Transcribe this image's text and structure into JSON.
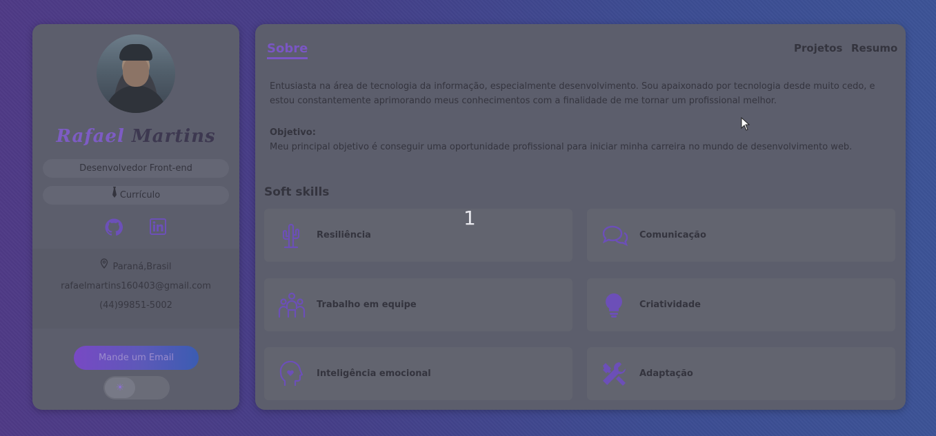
{
  "profile": {
    "first_name": "Rafael",
    "last_name": "Martins",
    "role": "Desenvolvedor Front-end",
    "resume_label": "Currículo",
    "social": [
      {
        "name": "github",
        "icon": "github-icon"
      },
      {
        "name": "linkedin",
        "icon": "linkedin-icon"
      }
    ],
    "location": "Paraná,Brasil",
    "email": "rafaelmartins160403@gmail.com",
    "phone": "(44)99851-5002",
    "email_button": "Mande um Email",
    "theme_toggle_icon": "☀"
  },
  "nav": {
    "active_tab": "Sobre",
    "tabs": [
      "Projetos",
      "Resumo"
    ]
  },
  "about": {
    "intro": "Entusiasta na área de tecnologia da informação, especialmente desenvolvimento. Sou apaixonado por tecnologia desde muito cedo, e estou constantemente aprimorando meus conhecimentos com a finalidade de me tornar um profissional melhor.",
    "objective_label": "Objetivo:",
    "objective": "Meu principal objetivo é conseguir uma oportunidade profissional para iniciar minha carreira no mundo de desenvolvimento web."
  },
  "skills": {
    "title": "Soft skills",
    "items": [
      {
        "label": "Resiliência",
        "icon": "cactus-icon"
      },
      {
        "label": "Comunicação",
        "icon": "chat-bubbles-icon"
      },
      {
        "label": "Trabalho em equipe",
        "icon": "team-icon"
      },
      {
        "label": "Criatividade",
        "icon": "lightbulb-icon"
      },
      {
        "label": "Inteligência emocional",
        "icon": "head-heart-icon"
      },
      {
        "label": "Adaptação",
        "icon": "tools-icon"
      }
    ]
  },
  "overlay": {
    "page_number": "1"
  },
  "colors": {
    "accent": "#7a56c4",
    "card": "#5c5e6c",
    "text": "#34343e"
  }
}
